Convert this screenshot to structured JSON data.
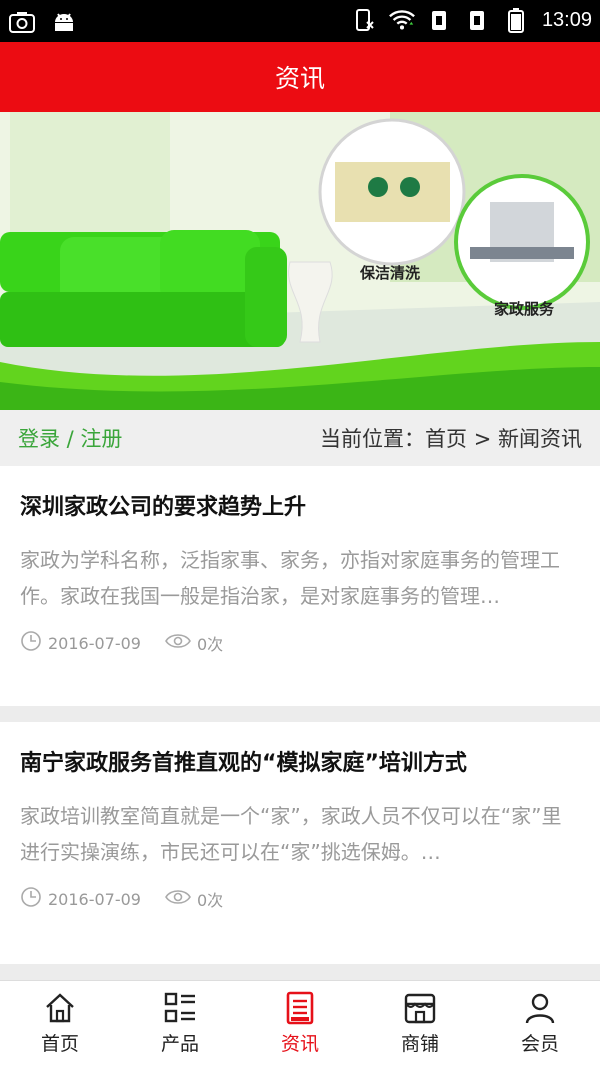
{
  "status_bar": {
    "time": "13:09"
  },
  "header": {
    "title": "资讯"
  },
  "banner": {
    "label_cleaning": "保洁清洗",
    "label_housekeeping": "家政服务"
  },
  "info_row": {
    "login": "登录 / 注册",
    "breadcrumb": "当前位置：首页 > 新闻资讯"
  },
  "articles": [
    {
      "title": "深圳家政公司的要求趋势上升",
      "summary": "家政为学科名称，泛指家事、家务，亦指对家庭事务的管理工作。家政在我国一般是指治家，是对家庭事务的管理…",
      "date": "2016-07-09",
      "views": "0次"
    },
    {
      "title": "南宁家政服务首推直观的“模拟家庭”培训方式",
      "summary": "家政培训教室简直就是一个“家”，家政人员不仅可以在“家”里进行实操演练，市民还可以在“家”挑选保姆。…",
      "date": "2016-07-09",
      "views": "0次"
    }
  ],
  "nav": [
    {
      "label": "首页",
      "icon": "home-icon"
    },
    {
      "label": "产品",
      "icon": "product-list-icon"
    },
    {
      "label": "资讯",
      "icon": "news-icon",
      "active": true
    },
    {
      "label": "商铺",
      "icon": "shop-icon"
    },
    {
      "label": "会员",
      "icon": "member-icon"
    }
  ],
  "colors": {
    "accent": "#ec0c12",
    "login_green": "#3aa53a",
    "active_nav": "#e61019"
  }
}
